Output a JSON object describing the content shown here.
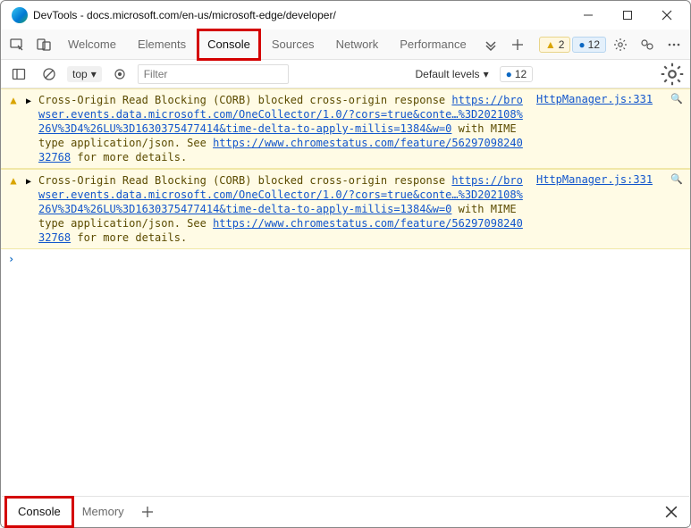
{
  "window": {
    "title": "DevTools - docs.microsoft.com/en-us/microsoft-edge/developer/"
  },
  "mainTabs": {
    "welcome": "Welcome",
    "elements": "Elements",
    "console": "Console",
    "sources": "Sources",
    "network": "Network",
    "performance": "Performance"
  },
  "badges": {
    "warn_count": "2",
    "info_count": "12"
  },
  "filterBar": {
    "context": "top",
    "filter_placeholder": "Filter",
    "levels_label": "Default levels",
    "issue_count": "12"
  },
  "messages": [
    {
      "prefix": "Cross-Origin Read Blocking (CORB) blocked cross-origin response ",
      "link1": "https://browser.events.data.microsoft.com/OneCollector/1.0/?cors=true&conte…%3D202108%26V%3D4%26LU%3D1630375477414&time-delta-to-apply-millis=1384&w=0",
      "mid": " with MIME type application/json. See ",
      "link2": "https://www.chromestatus.com/feature/5629709824032768",
      "suffix": " for more details.",
      "source": "HttpManager.js:331"
    },
    {
      "prefix": "Cross-Origin Read Blocking (CORB) blocked cross-origin response ",
      "link1": "https://browser.events.data.microsoft.com/OneCollector/1.0/?cors=true&conte…%3D202108%26V%3D4%26LU%3D1630375477414&time-delta-to-apply-millis=1384&w=0",
      "mid": " with MIME type application/json. See ",
      "link2": "https://www.chromestatus.com/feature/5629709824032768",
      "suffix": " for more details.",
      "source": "HttpManager.js:331"
    }
  ],
  "prompt": "›",
  "drawer": {
    "console": "Console",
    "memory": "Memory"
  }
}
